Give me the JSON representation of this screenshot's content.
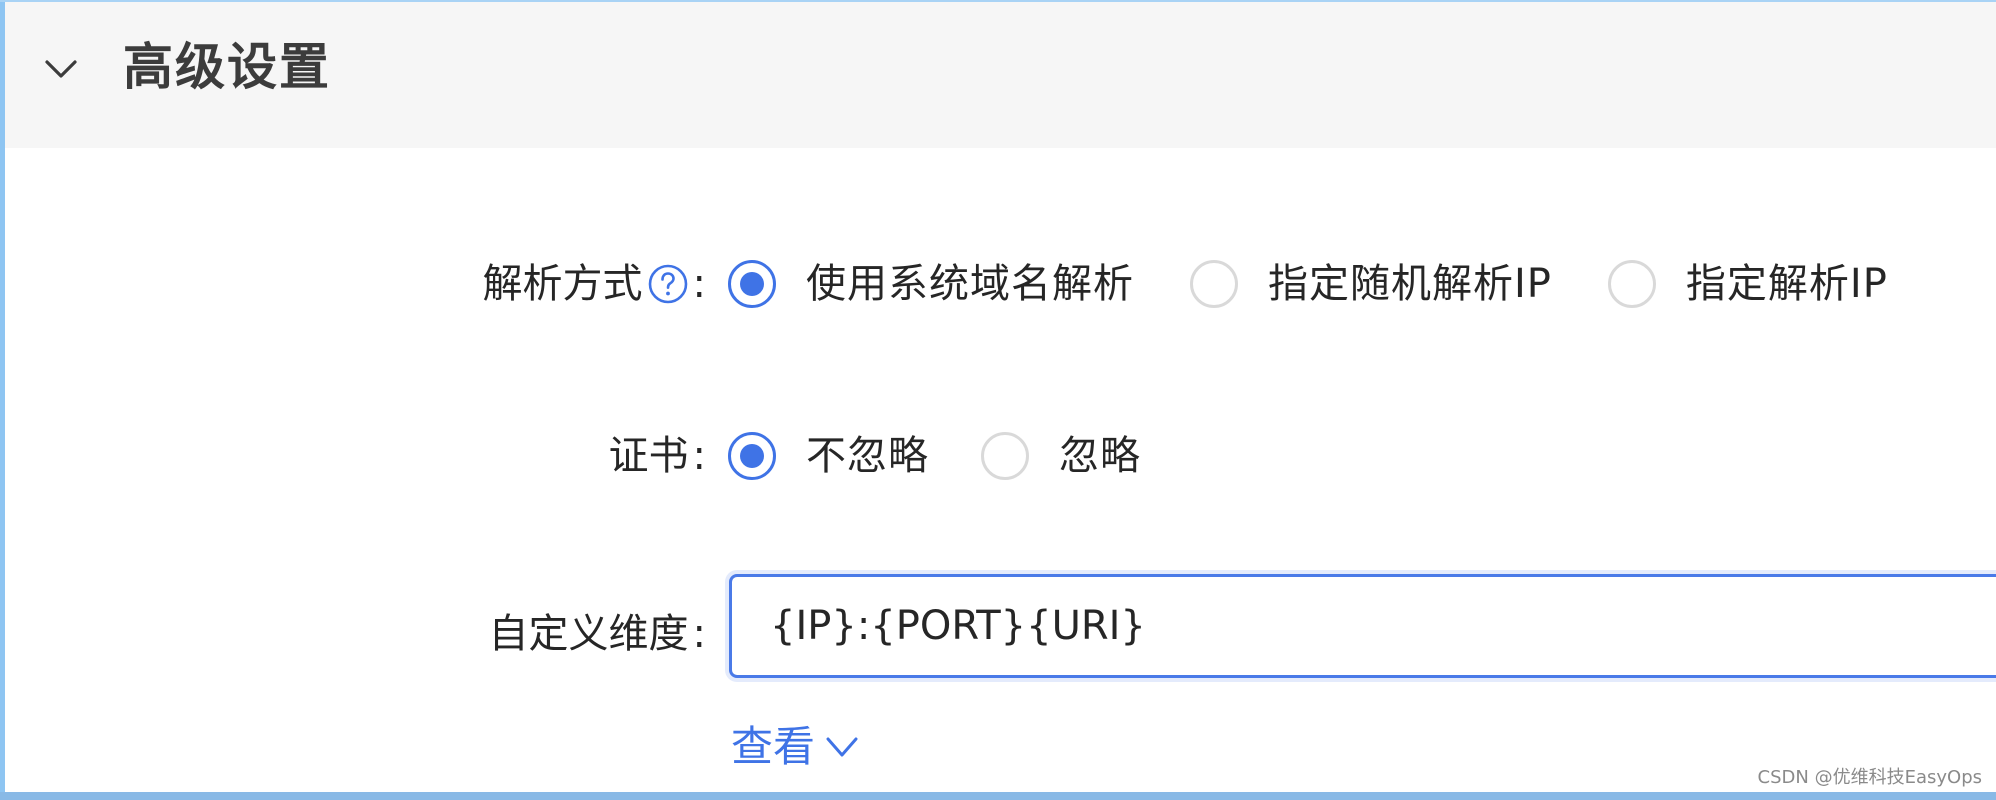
{
  "section": {
    "title": "高级设置",
    "icon": "chevron-down-icon"
  },
  "form": {
    "resolve_mode": {
      "label": "解析方式",
      "colon": ":",
      "help_icon": "question-circle-icon",
      "options": [
        {
          "label": "使用系统域名解析",
          "checked": true
        },
        {
          "label": "指定随机解析IP",
          "checked": false
        },
        {
          "label": "指定解析IP",
          "checked": false
        }
      ]
    },
    "certificate": {
      "label": "证书",
      "colon": ":",
      "options": [
        {
          "label": "不忽略",
          "checked": true
        },
        {
          "label": "忽略",
          "checked": false
        }
      ]
    },
    "custom_dimension": {
      "label": "自定义维度",
      "colon": ":",
      "value": "{IP}:{PORT}{URI}"
    },
    "view_link": {
      "label": "查看",
      "icon": "chevron-down-icon"
    }
  },
  "watermark": "CSDN @优维科技EasyOps",
  "colors": {
    "accent": "#3f73e6",
    "header_bg": "#f6f6f6",
    "text": "#262626",
    "radio_border": "#d9d9d9"
  }
}
